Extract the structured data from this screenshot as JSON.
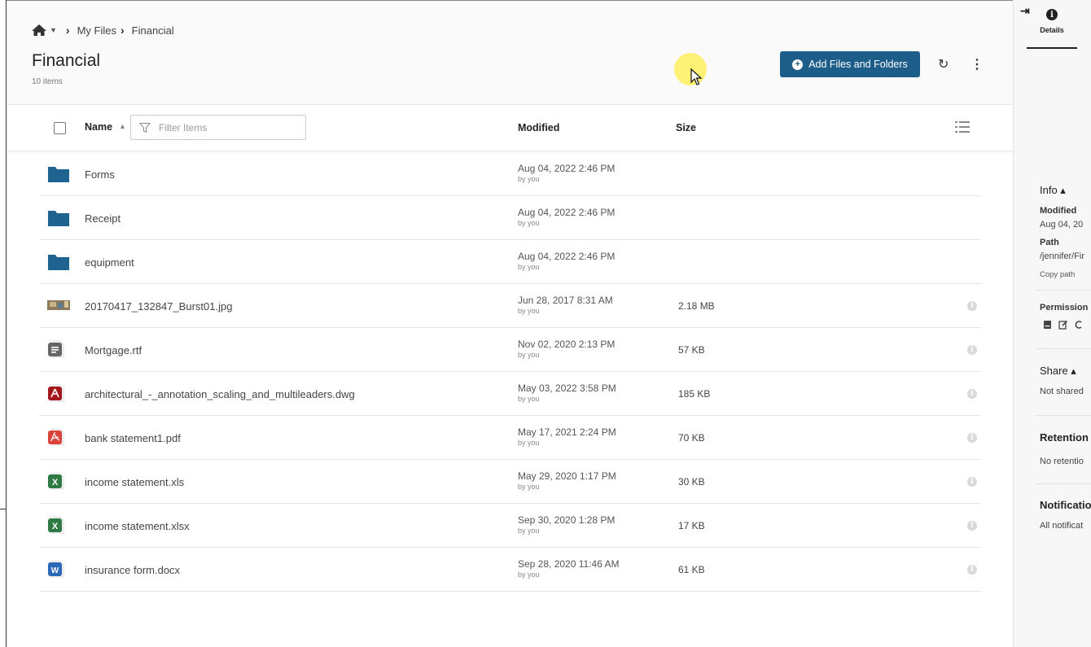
{
  "breadcrumb": {
    "items": [
      "My Files",
      "Financial"
    ]
  },
  "header": {
    "title": "Financial",
    "item_count": "10 items",
    "add_button_label": "Add Files and Folders"
  },
  "columns": {
    "name": "Name",
    "modified": "Modified",
    "size": "Size",
    "filter_placeholder": "Filter Items"
  },
  "files": [
    {
      "name": "Forms",
      "type": "folder",
      "modified": "Aug 04, 2022 2:46 PM",
      "by": "by you",
      "size": ""
    },
    {
      "name": "Receipt",
      "type": "folder",
      "modified": "Aug 04, 2022 2:46 PM",
      "by": "by you",
      "size": ""
    },
    {
      "name": "equipment",
      "type": "folder",
      "modified": "Aug 04, 2022 2:46 PM",
      "by": "by you",
      "size": ""
    },
    {
      "name": "20170417_132847_Burst01.jpg",
      "type": "image",
      "modified": "Jun 28, 2017 8:31 AM",
      "by": "by you",
      "size": "2.18 MB"
    },
    {
      "name": "Mortgage.rtf",
      "type": "text",
      "modified": "Nov 02, 2020 2:13 PM",
      "by": "by you",
      "size": "57 KB"
    },
    {
      "name": "architectural_-_annotation_scaling_and_multileaders.dwg",
      "type": "dwg",
      "modified": "May 03, 2022 3:58 PM",
      "by": "by you",
      "size": "185 KB"
    },
    {
      "name": "bank statement1.pdf",
      "type": "pdf",
      "modified": "May 17, 2021 2:24 PM",
      "by": "by you",
      "size": "70 KB"
    },
    {
      "name": "income statement.xls",
      "type": "excel",
      "modified": "May 29, 2020 1:17 PM",
      "by": "by you",
      "size": "30 KB"
    },
    {
      "name": "income statement.xlsx",
      "type": "excel",
      "modified": "Sep 30, 2020 1:28 PM",
      "by": "by you",
      "size": "17 KB"
    },
    {
      "name": "insurance form.docx",
      "type": "word",
      "modified": "Sep 28, 2020 11:46 AM",
      "by": "by you",
      "size": "61 KB"
    }
  ],
  "panel": {
    "tab_label": "Details",
    "info_title": "Info ▴",
    "modified_label": "Modified",
    "modified_value": "Aug 04, 20",
    "path_label": "Path",
    "path_value": "/jennifer/Fir",
    "copy_path": "Copy path",
    "permissions_label": "Permission",
    "share_title": "Share ▴",
    "share_value": "Not shared",
    "retention_title": "Retention",
    "retention_value": "No retentio",
    "notifications_title": "Notificatio",
    "notifications_value": "All notificat"
  },
  "colors": {
    "primary": "#1d5d8a",
    "folder": "#1f6390",
    "pdf": "#d9433a",
    "dwg": "#a3161c",
    "excel": "#2f7a44",
    "word": "#2c69b8",
    "text_doc": "#666666"
  }
}
